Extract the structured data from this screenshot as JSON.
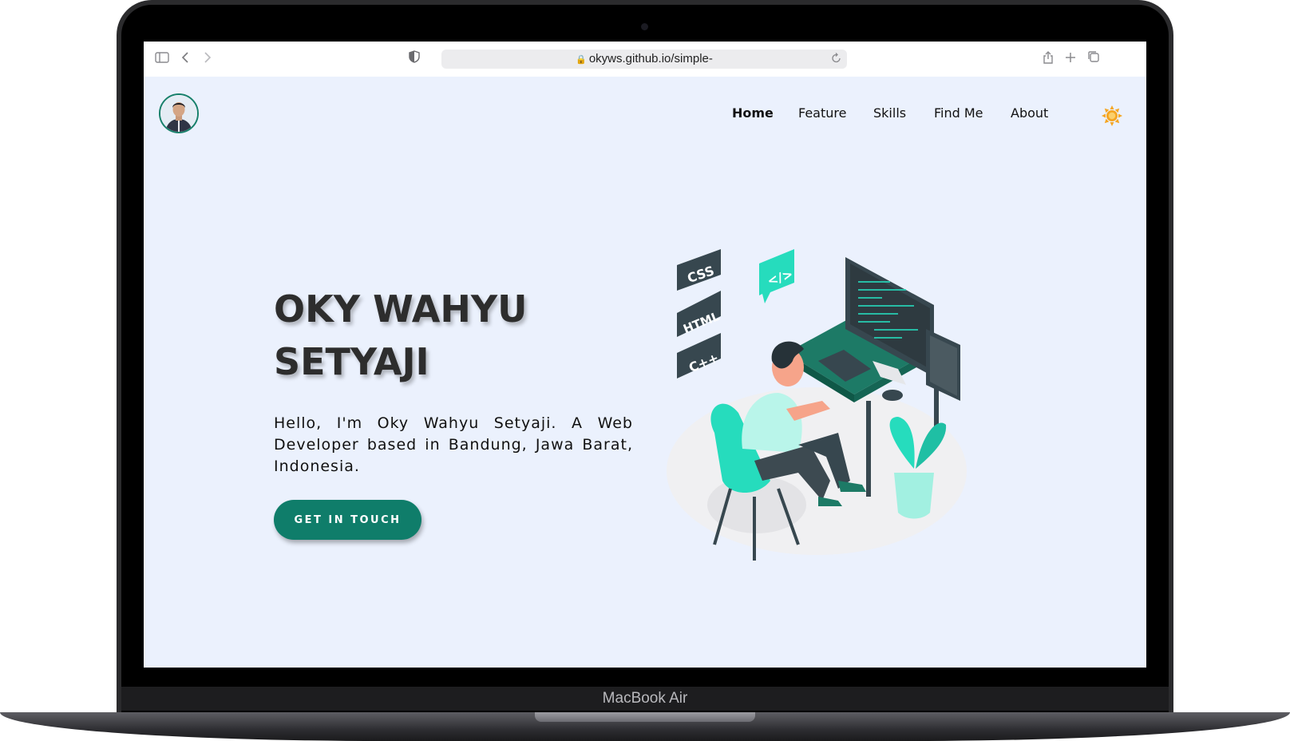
{
  "device": {
    "model_label": "MacBook Air"
  },
  "browser": {
    "url": "okyws.github.io/simple-",
    "icons": [
      "sidebar-icon",
      "back-icon",
      "forward-icon",
      "shield-icon",
      "reload-icon",
      "share-icon",
      "new-tab-icon",
      "tabs-overview-icon"
    ]
  },
  "nav": {
    "items": [
      {
        "label": "Home",
        "active": true
      },
      {
        "label": "Feature",
        "active": false
      },
      {
        "label": "Skills",
        "active": false
      },
      {
        "label": "Find Me",
        "active": false
      },
      {
        "label": "About",
        "active": false
      }
    ],
    "theme_toggle_icon": "sun-icon"
  },
  "hero": {
    "title_line1": "OKY WAHYU",
    "title_line2": "SETYAJI",
    "description": "Hello, I'm Oky Wahyu Setyaji. A Web Developer based in Bandung, Jawa Barat, Indonesia.",
    "cta_label": "GET IN TOUCH",
    "illustration_tags": [
      "CSS",
      "HTML",
      "C++",
      "</>"
    ]
  },
  "colors": {
    "accent": "#0f7d6a",
    "mint": "#26dcbd",
    "page_bg": "#ebf1fd",
    "sun": "#f5a623"
  }
}
